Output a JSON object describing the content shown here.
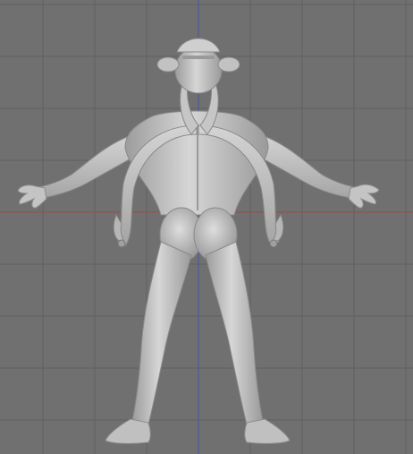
{
  "viewport": {
    "background": "#707070",
    "grid_color": "#606060",
    "x_axis_color": "#9a4a4a",
    "z_axis_color": "#4a55a0"
  },
  "model": {
    "name": "humanoid-figure",
    "view": "back",
    "material_color": "#c8c8c8",
    "shadow_color": "#8a8a8a"
  }
}
